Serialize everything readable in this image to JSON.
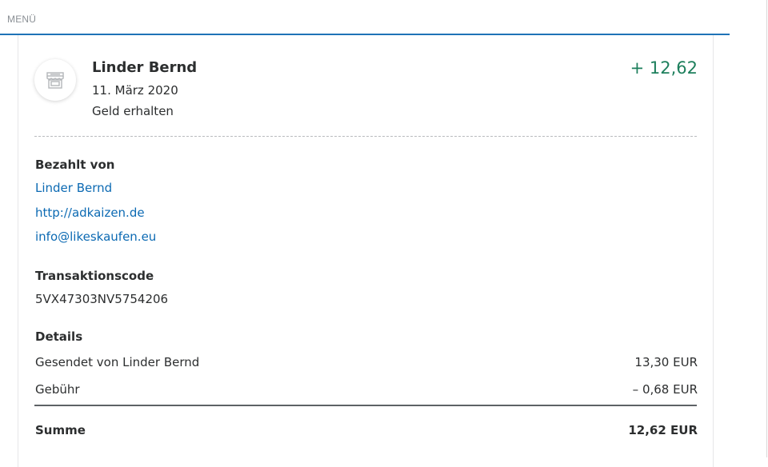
{
  "header": {
    "menu_label": "MENÜ"
  },
  "transaction": {
    "icon": "storefront-icon",
    "name": "Linder Bernd",
    "date": "11. März 2020",
    "status": "Geld erhalten",
    "amount": "+ 12,62",
    "amount_color": "#1d7f5c"
  },
  "paid_by": {
    "title": "Bezahlt von",
    "name": "Linder Bernd",
    "website": "http://adkaizen.de",
    "email": "info@likeskaufen.eu"
  },
  "transaction_code": {
    "title": "Transaktionscode",
    "value": "5VX47303NV5754206"
  },
  "details": {
    "title": "Details",
    "rows": [
      {
        "label": "Gesendet von Linder Bernd",
        "value": "13,30 EUR"
      },
      {
        "label": "Gebühr",
        "value": "– 0,68 EUR"
      }
    ],
    "total_label": "Summe",
    "total_value": "12,62 EUR"
  },
  "colors": {
    "link": "#0c6ab3",
    "accent_border": "#1f73b7"
  }
}
